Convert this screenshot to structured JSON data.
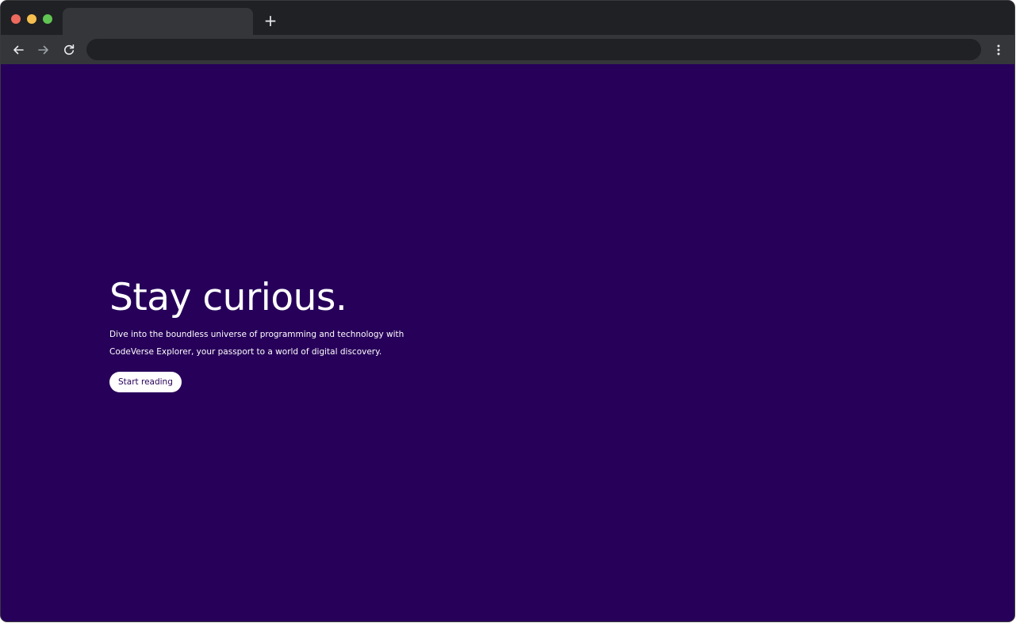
{
  "browser": {
    "tab_title": "",
    "new_tab_label": "+",
    "address": "",
    "icons": {
      "close": "traffic-light-red",
      "minimize": "traffic-light-yellow",
      "maximize": "traffic-light-green",
      "back": "arrow-left-icon",
      "forward": "arrow-right-icon",
      "reload": "reload-icon",
      "menu": "kebab-menu-icon"
    }
  },
  "hero": {
    "title": "Stay curious.",
    "description": "Dive into the boundless universe of programming and technology with CodeVerse Explorer, your passport to a world of digital discovery.",
    "cta_label": "Start reading"
  },
  "colors": {
    "background": "#27005a",
    "text": "#ffffff",
    "button_bg": "#ffffff",
    "button_text": "#27005a"
  }
}
